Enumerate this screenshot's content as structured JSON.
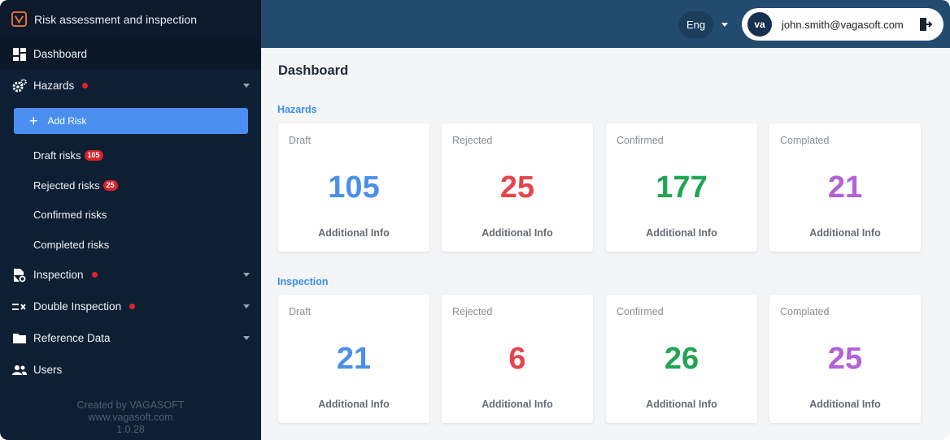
{
  "app": {
    "title": "Risk assessment and inspection"
  },
  "sidebar": {
    "dashboard": "Dashboard",
    "hazards": "Hazards",
    "add_risk": "Add Risk",
    "sub": [
      {
        "label": "Draft risks",
        "badge": "105"
      },
      {
        "label": "Rejected risks",
        "badge": "25"
      },
      {
        "label": "Confirmed risks",
        "badge": ""
      },
      {
        "label": "Completed risks",
        "badge": ""
      }
    ],
    "inspection": "Inspection",
    "double_inspection": "Double Inspection",
    "reference_data": "Reference Data",
    "users": "Users",
    "footer": [
      "Created by VAGASOFT",
      "www.vagasoft.com",
      "1.0.28"
    ]
  },
  "header": {
    "language": "Eng",
    "avatar_initials": "va",
    "email": "john.smith@vagasoft.com"
  },
  "main": {
    "title": "Dashboard",
    "sections": [
      {
        "title": "Hazards",
        "cards": [
          {
            "label": "Draft",
            "value": "105",
            "info": "Additional Info",
            "color": "#4a90e8"
          },
          {
            "label": "Rejected",
            "value": "25",
            "info": "Additional Info",
            "color": "#e5454d"
          },
          {
            "label": "Confirmed",
            "value": "177",
            "info": "Additional Info",
            "color": "#22a455"
          },
          {
            "label": "Complated",
            "value": "21",
            "info": "Additional Info",
            "color": "#b361d6"
          }
        ]
      },
      {
        "title": "Inspection",
        "cards": [
          {
            "label": "Draft",
            "value": "21",
            "info": "Additional Info",
            "color": "#4a90e8"
          },
          {
            "label": "Rejected",
            "value": "6",
            "info": "Additional Info",
            "color": "#e5454d"
          },
          {
            "label": "Confirmed",
            "value": "26",
            "info": "Additional Info",
            "color": "#22a455"
          },
          {
            "label": "Complated",
            "value": "25",
            "info": "Additional Info",
            "color": "#b361d6"
          }
        ]
      }
    ]
  },
  "colors": {
    "sidebar": "#0f1f33",
    "topbar": "#234a6f",
    "accent": "#4a8ff0",
    "badge": "#d8232a"
  }
}
